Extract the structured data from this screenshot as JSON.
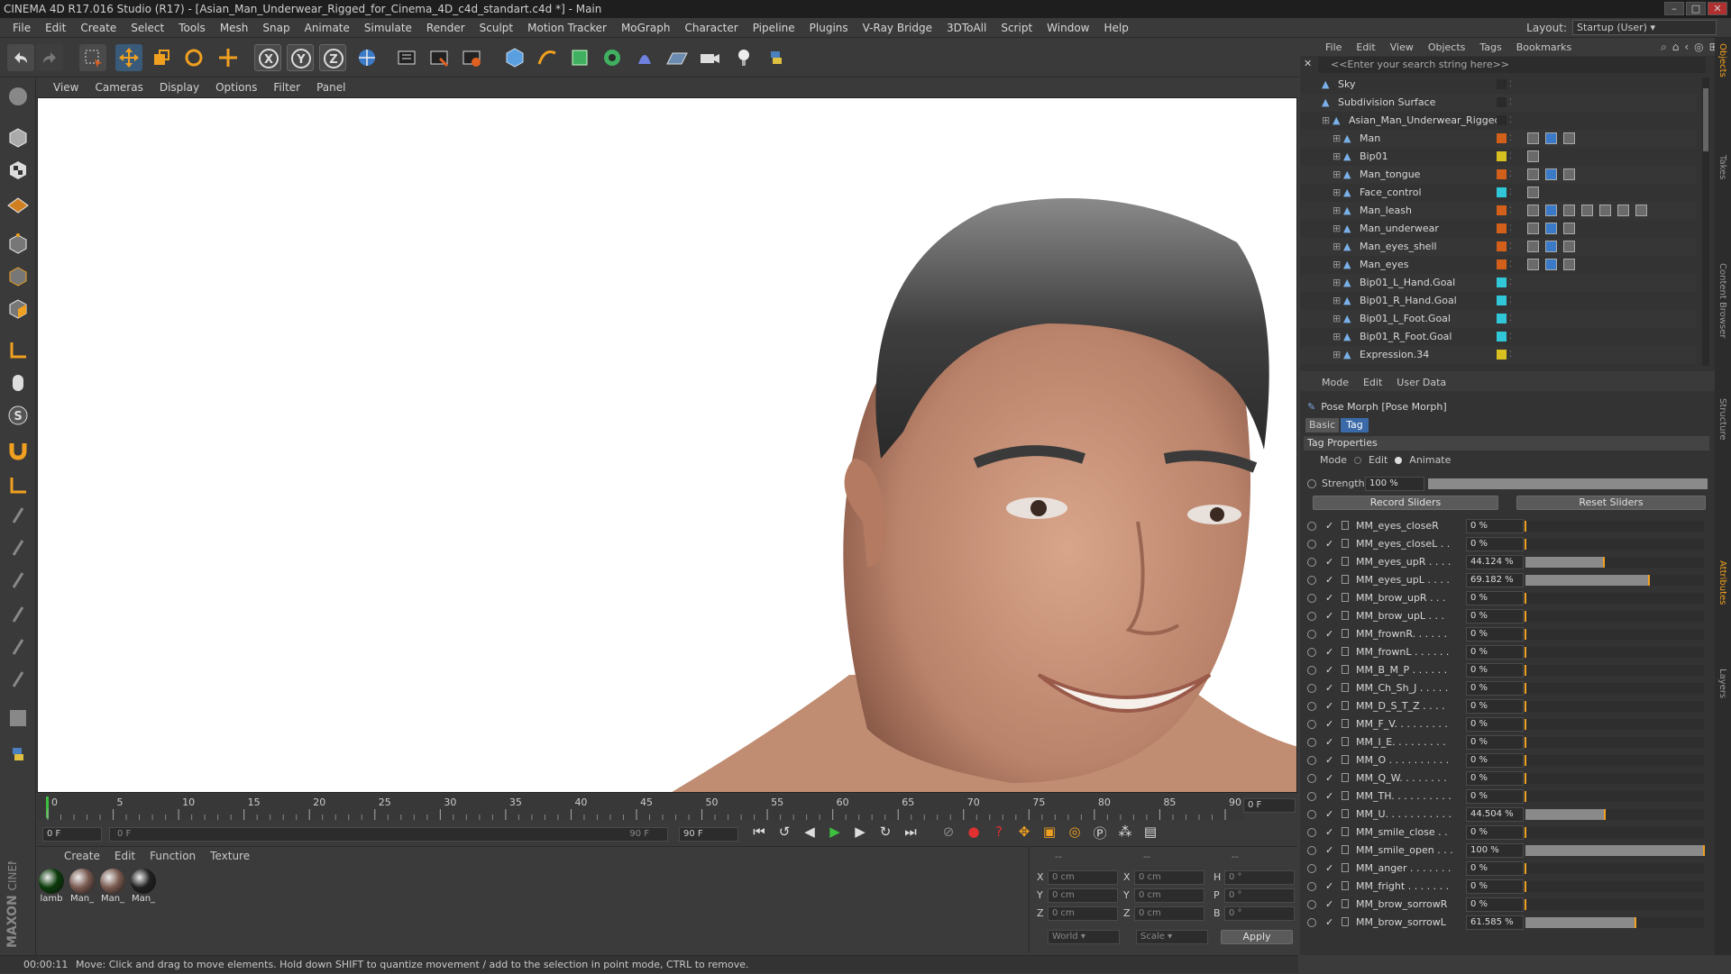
{
  "window": {
    "title": "CINEMA 4D R17.016 Studio (R17) - [Asian_Man_Underwear_Rigged_for_Cinema_4D_c4d_standart.c4d *] - Main"
  },
  "menu": [
    "File",
    "Edit",
    "Create",
    "Select",
    "Tools",
    "Mesh",
    "Snap",
    "Animate",
    "Simulate",
    "Render",
    "Sculpt",
    "Motion Tracker",
    "MoGraph",
    "Character",
    "Pipeline",
    "Plugins",
    "V-Ray Bridge",
    "3DToAll",
    "Script",
    "Window",
    "Help"
  ],
  "layout": {
    "label": "Layout:",
    "value": "Startup (User)"
  },
  "viewport": {
    "menu": [
      "View",
      "Cameras",
      "Display",
      "Options",
      "Filter",
      "Panel"
    ]
  },
  "timeline": {
    "ticks": [
      "0",
      "5",
      "10",
      "15",
      "20",
      "25",
      "30",
      "35",
      "40",
      "45",
      "50",
      "55",
      "60",
      "65",
      "70",
      "75",
      "80",
      "85",
      "90"
    ],
    "current_frame": "0 F",
    "start_field": "0 F",
    "range_start": "0 F",
    "range_end": "90 F",
    "end_field": "90 F"
  },
  "material_manager": {
    "menu": [
      "Create",
      "Edit",
      "Function",
      "Texture"
    ],
    "materials": [
      {
        "label": "lamb",
        "color": "#0a3a0a"
      },
      {
        "label": "Man_",
        "color": "#7a5a50"
      },
      {
        "label": "Man_",
        "color": "#7a5a50"
      },
      {
        "label": "Man_",
        "color": "#202020"
      }
    ]
  },
  "coord_manager": {
    "headers": [
      "--",
      "--",
      "--"
    ],
    "rows": [
      {
        "a": "X",
        "av": "0 cm",
        "b": "X",
        "bv": "0 cm",
        "c": "H",
        "cv": "0 °"
      },
      {
        "a": "Y",
        "av": "0 cm",
        "b": "Y",
        "bv": "0 cm",
        "c": "P",
        "cv": "0 °"
      },
      {
        "a": "Z",
        "av": "0 cm",
        "b": "Z",
        "bv": "0 cm",
        "c": "B",
        "cv": "0 °"
      }
    ],
    "world": "World",
    "scale": "Scale",
    "apply": "Apply"
  },
  "status": {
    "time": "00:00:11",
    "message": "Move: Click and drag to move elements. Hold down SHIFT to quantize movement / add to the selection in point mode, CTRL to remove."
  },
  "object_manager": {
    "menu": [
      "File",
      "Edit",
      "View",
      "Objects",
      "Tags",
      "Bookmarks"
    ],
    "search_placeholder": "<<Enter your search string here>>",
    "objects": [
      {
        "name": "Sky",
        "indent": 0,
        "color": "#2a2a2a"
      },
      {
        "name": "Subdivision Surface",
        "indent": 0,
        "color": "#2a2a2a"
      },
      {
        "name": "Asian_Man_Underwear_Rigged",
        "indent": 1,
        "color": "#2a2a2a"
      },
      {
        "name": "Man",
        "indent": 2,
        "color": "#d2601a"
      },
      {
        "name": "Bip01",
        "indent": 2,
        "color": "#d8c020"
      },
      {
        "name": "Man_tongue",
        "indent": 2,
        "color": "#d2601a"
      },
      {
        "name": "Face_control",
        "indent": 2,
        "color": "#30c8d8"
      },
      {
        "name": "Man_leash",
        "indent": 2,
        "color": "#d2601a"
      },
      {
        "name": "Man_underwear",
        "indent": 2,
        "color": "#d2601a"
      },
      {
        "name": "Man_eyes_shell",
        "indent": 2,
        "color": "#d2601a"
      },
      {
        "name": "Man_eyes",
        "indent": 2,
        "color": "#d2601a"
      },
      {
        "name": "Bip01_L_Hand.Goal",
        "indent": 2,
        "color": "#30c8d8"
      },
      {
        "name": "Bip01_R_Hand.Goal",
        "indent": 2,
        "color": "#30c8d8"
      },
      {
        "name": "Bip01_L_Foot.Goal",
        "indent": 2,
        "color": "#30c8d8"
      },
      {
        "name": "Bip01_R_Foot.Goal",
        "indent": 2,
        "color": "#30c8d8"
      },
      {
        "name": "Expression.34",
        "indent": 2,
        "color": "#d8c020"
      }
    ]
  },
  "attribute_manager": {
    "menu": [
      "Mode",
      "Edit",
      "User Data"
    ],
    "object_title": "Pose Morph [Pose Morph]",
    "tabs": [
      "Basic",
      "Tag"
    ],
    "section": "Tag Properties",
    "mode_label": "Mode",
    "mode_options": [
      "Edit",
      "Animate"
    ],
    "strength_label": "Strength",
    "strength_value": "100 %",
    "record_button": "Record Sliders",
    "reset_button": "Reset Sliders",
    "morphs": [
      {
        "name": "MM_eyes_closeR",
        "value": "0 %",
        "level": 0
      },
      {
        "name": "MM_eyes_closeL . .",
        "value": "0 %",
        "level": 0
      },
      {
        "name": "MM_eyes_upR . . . .",
        "value": "44.124 %",
        "level": 0.44124
      },
      {
        "name": "MM_eyes_upL . . . .",
        "value": "69.182 %",
        "level": 0.69182
      },
      {
        "name": "MM_brow_upR . . .",
        "value": "0 %",
        "level": 0
      },
      {
        "name": "MM_brow_upL . . .",
        "value": "0 %",
        "level": 0
      },
      {
        "name": "MM_frownR. . . . . .",
        "value": "0 %",
        "level": 0
      },
      {
        "name": "MM_frownL . . . . . .",
        "value": "0 %",
        "level": 0
      },
      {
        "name": "MM_B_M_P . . . . . .",
        "value": "0 %",
        "level": 0
      },
      {
        "name": "MM_Ch_Sh_J . . . . .",
        "value": "0 %",
        "level": 0
      },
      {
        "name": "MM_D_S_T_Z . . . .",
        "value": "0 %",
        "level": 0
      },
      {
        "name": "MM_F_V. . . . . . . . .",
        "value": "0 %",
        "level": 0
      },
      {
        "name": "MM_I_E. . . . . . . . .",
        "value": "0 %",
        "level": 0
      },
      {
        "name": "MM_O . . . . . . . . . .",
        "value": "0 %",
        "level": 0
      },
      {
        "name": "MM_Q_W. . . . . . . .",
        "value": "0 %",
        "level": 0
      },
      {
        "name": "MM_TH. . . . . . . . . .",
        "value": "0 %",
        "level": 0
      },
      {
        "name": "MM_U. . . . . . . . . . .",
        "value": "44.504 %",
        "level": 0.44504
      },
      {
        "name": "MM_smile_close . .",
        "value": "0 %",
        "level": 0
      },
      {
        "name": "MM_smile_open . . .",
        "value": "100 %",
        "level": 1
      },
      {
        "name": "MM_anger . . . . . . .",
        "value": "0 %",
        "level": 0
      },
      {
        "name": "MM_fright . . . . . . .",
        "value": "0 %",
        "level": 0
      },
      {
        "name": "MM_brow_sorrowR",
        "value": "0 %",
        "level": 0
      },
      {
        "name": "MM_brow_sorrowL",
        "value": "61.585 %",
        "level": 0.61585
      }
    ]
  },
  "side_tabs": [
    "Objects",
    "Takes",
    "Content Browser",
    "Structure",
    "Attributes",
    "Layers"
  ],
  "brand": [
    "MAXON",
    "CINEMA 4D"
  ],
  "colors": {
    "accent": "#f0a020",
    "tag_blue": "#3a7ac8"
  }
}
